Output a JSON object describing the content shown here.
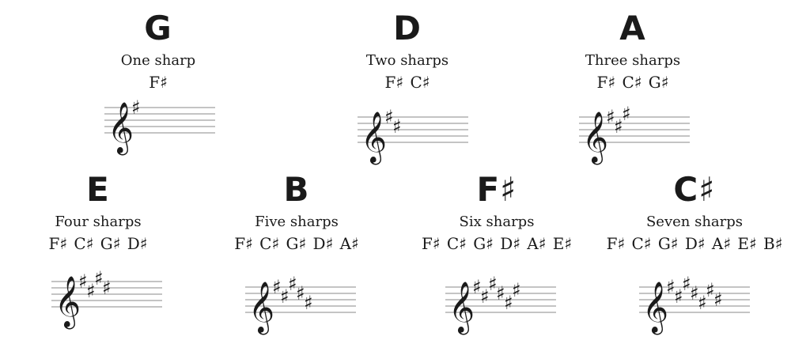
{
  "keys": [
    {
      "name": "G",
      "desc": "One sharp",
      "notes": "F♯",
      "sharp_count": 1
    },
    {
      "name": "D",
      "desc": "Two sharps",
      "notes": "F♯ C♯",
      "sharp_count": 2
    },
    {
      "name": "A",
      "desc": "Three sharps",
      "notes": "F♯ C♯ G♯",
      "sharp_count": 3
    },
    {
      "name": "E",
      "desc": "Four sharps",
      "notes": "F♯ C♯ G♯ D♯",
      "sharp_count": 4
    },
    {
      "name": "B",
      "desc": "Five sharps",
      "notes": "F♯ C♯ G♯ D♯ A♯",
      "sharp_count": 5
    },
    {
      "name": "F♯",
      "desc": "Six sharps",
      "notes": "F♯ C♯ G♯ D♯ A♯ E♯",
      "sharp_count": 6
    },
    {
      "name": "C♯",
      "desc": "Seven sharps",
      "notes": "F♯ C♯ G♯ D♯ A♯ E♯ B♯",
      "sharp_count": 7
    }
  ],
  "symbols": {
    "clef": "𝄞",
    "sharp": "♯",
    "clef_icon": "treble-clef-icon",
    "sharp_icon": "sharp-icon"
  },
  "colors": {
    "ink": "#1a1a1a",
    "staff_line": "#8a8a8a"
  }
}
